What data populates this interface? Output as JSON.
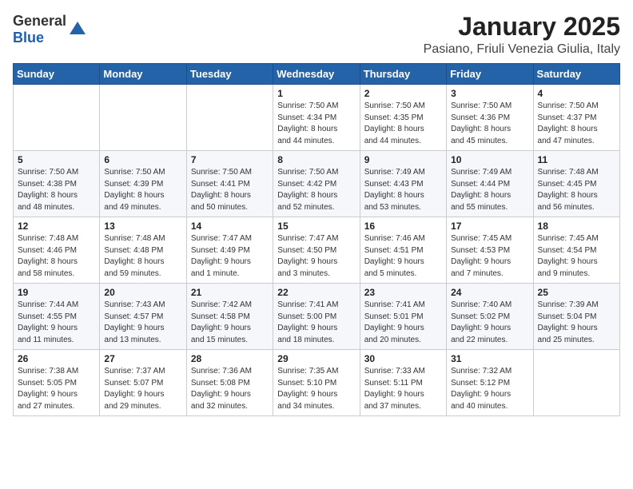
{
  "header": {
    "logo_general": "General",
    "logo_blue": "Blue",
    "month_title": "January 2025",
    "location": "Pasiano, Friuli Venezia Giulia, Italy"
  },
  "days_of_week": [
    "Sunday",
    "Monday",
    "Tuesday",
    "Wednesday",
    "Thursday",
    "Friday",
    "Saturday"
  ],
  "weeks": [
    [
      {
        "day": "",
        "info": ""
      },
      {
        "day": "",
        "info": ""
      },
      {
        "day": "",
        "info": ""
      },
      {
        "day": "1",
        "info": "Sunrise: 7:50 AM\nSunset: 4:34 PM\nDaylight: 8 hours\nand 44 minutes."
      },
      {
        "day": "2",
        "info": "Sunrise: 7:50 AM\nSunset: 4:35 PM\nDaylight: 8 hours\nand 44 minutes."
      },
      {
        "day": "3",
        "info": "Sunrise: 7:50 AM\nSunset: 4:36 PM\nDaylight: 8 hours\nand 45 minutes."
      },
      {
        "day": "4",
        "info": "Sunrise: 7:50 AM\nSunset: 4:37 PM\nDaylight: 8 hours\nand 47 minutes."
      }
    ],
    [
      {
        "day": "5",
        "info": "Sunrise: 7:50 AM\nSunset: 4:38 PM\nDaylight: 8 hours\nand 48 minutes."
      },
      {
        "day": "6",
        "info": "Sunrise: 7:50 AM\nSunset: 4:39 PM\nDaylight: 8 hours\nand 49 minutes."
      },
      {
        "day": "7",
        "info": "Sunrise: 7:50 AM\nSunset: 4:41 PM\nDaylight: 8 hours\nand 50 minutes."
      },
      {
        "day": "8",
        "info": "Sunrise: 7:50 AM\nSunset: 4:42 PM\nDaylight: 8 hours\nand 52 minutes."
      },
      {
        "day": "9",
        "info": "Sunrise: 7:49 AM\nSunset: 4:43 PM\nDaylight: 8 hours\nand 53 minutes."
      },
      {
        "day": "10",
        "info": "Sunrise: 7:49 AM\nSunset: 4:44 PM\nDaylight: 8 hours\nand 55 minutes."
      },
      {
        "day": "11",
        "info": "Sunrise: 7:48 AM\nSunset: 4:45 PM\nDaylight: 8 hours\nand 56 minutes."
      }
    ],
    [
      {
        "day": "12",
        "info": "Sunrise: 7:48 AM\nSunset: 4:46 PM\nDaylight: 8 hours\nand 58 minutes."
      },
      {
        "day": "13",
        "info": "Sunrise: 7:48 AM\nSunset: 4:48 PM\nDaylight: 8 hours\nand 59 minutes."
      },
      {
        "day": "14",
        "info": "Sunrise: 7:47 AM\nSunset: 4:49 PM\nDaylight: 9 hours\nand 1 minute."
      },
      {
        "day": "15",
        "info": "Sunrise: 7:47 AM\nSunset: 4:50 PM\nDaylight: 9 hours\nand 3 minutes."
      },
      {
        "day": "16",
        "info": "Sunrise: 7:46 AM\nSunset: 4:51 PM\nDaylight: 9 hours\nand 5 minutes."
      },
      {
        "day": "17",
        "info": "Sunrise: 7:45 AM\nSunset: 4:53 PM\nDaylight: 9 hours\nand 7 minutes."
      },
      {
        "day": "18",
        "info": "Sunrise: 7:45 AM\nSunset: 4:54 PM\nDaylight: 9 hours\nand 9 minutes."
      }
    ],
    [
      {
        "day": "19",
        "info": "Sunrise: 7:44 AM\nSunset: 4:55 PM\nDaylight: 9 hours\nand 11 minutes."
      },
      {
        "day": "20",
        "info": "Sunrise: 7:43 AM\nSunset: 4:57 PM\nDaylight: 9 hours\nand 13 minutes."
      },
      {
        "day": "21",
        "info": "Sunrise: 7:42 AM\nSunset: 4:58 PM\nDaylight: 9 hours\nand 15 minutes."
      },
      {
        "day": "22",
        "info": "Sunrise: 7:41 AM\nSunset: 5:00 PM\nDaylight: 9 hours\nand 18 minutes."
      },
      {
        "day": "23",
        "info": "Sunrise: 7:41 AM\nSunset: 5:01 PM\nDaylight: 9 hours\nand 20 minutes."
      },
      {
        "day": "24",
        "info": "Sunrise: 7:40 AM\nSunset: 5:02 PM\nDaylight: 9 hours\nand 22 minutes."
      },
      {
        "day": "25",
        "info": "Sunrise: 7:39 AM\nSunset: 5:04 PM\nDaylight: 9 hours\nand 25 minutes."
      }
    ],
    [
      {
        "day": "26",
        "info": "Sunrise: 7:38 AM\nSunset: 5:05 PM\nDaylight: 9 hours\nand 27 minutes."
      },
      {
        "day": "27",
        "info": "Sunrise: 7:37 AM\nSunset: 5:07 PM\nDaylight: 9 hours\nand 29 minutes."
      },
      {
        "day": "28",
        "info": "Sunrise: 7:36 AM\nSunset: 5:08 PM\nDaylight: 9 hours\nand 32 minutes."
      },
      {
        "day": "29",
        "info": "Sunrise: 7:35 AM\nSunset: 5:10 PM\nDaylight: 9 hours\nand 34 minutes."
      },
      {
        "day": "30",
        "info": "Sunrise: 7:33 AM\nSunset: 5:11 PM\nDaylight: 9 hours\nand 37 minutes."
      },
      {
        "day": "31",
        "info": "Sunrise: 7:32 AM\nSunset: 5:12 PM\nDaylight: 9 hours\nand 40 minutes."
      },
      {
        "day": "",
        "info": ""
      }
    ]
  ]
}
